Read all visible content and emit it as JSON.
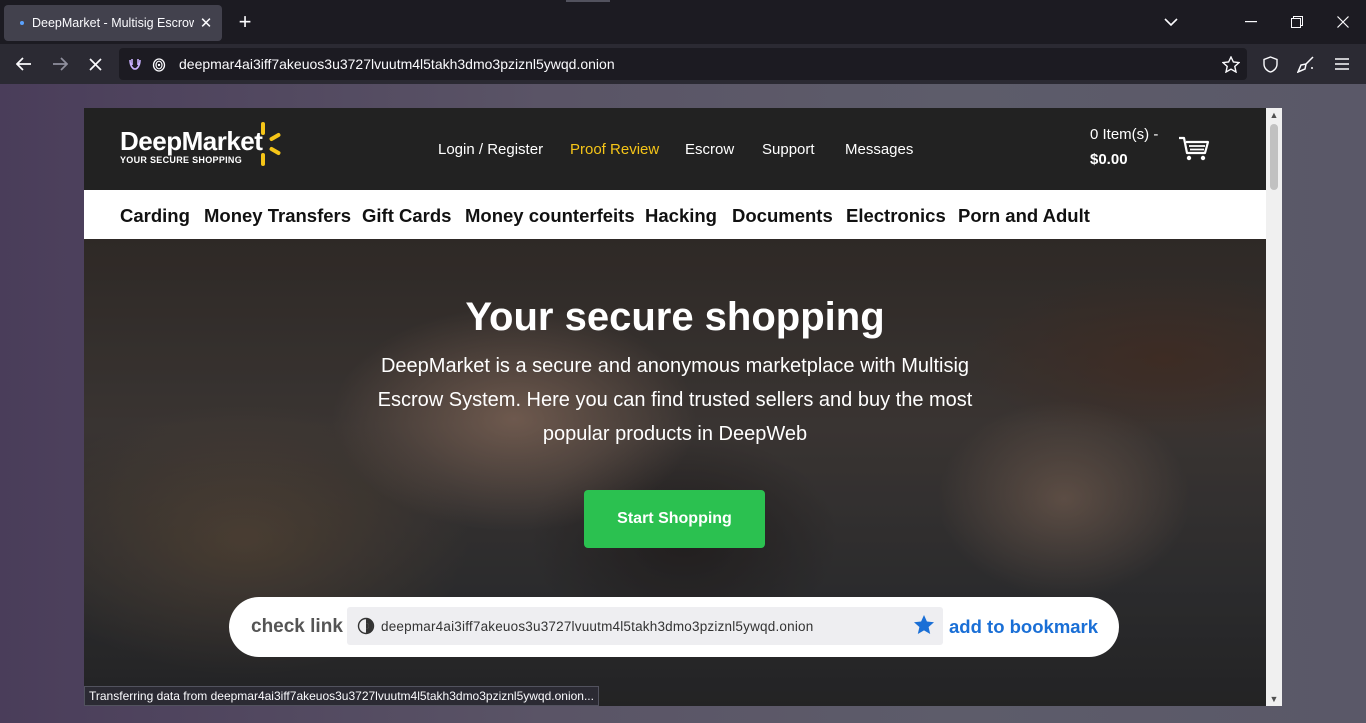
{
  "browser": {
    "tab_title": "DeepMarket - Multisig Escrow M",
    "new_tab": "+",
    "url": "deepmar4ai3iff7akeuos3u3727lvuutm4l5takh3dmo3pziznl5ywqd.onion",
    "status": "Transferring data from deepmar4ai3iff7akeuos3u3727lvuutm4l5takh3dmo3pziznl5ywqd.onion..."
  },
  "header": {
    "logo_name": "DeepMarket",
    "logo_tagline": "YOUR SECURE SHOPPING",
    "menu": [
      {
        "label": "Login / Register"
      },
      {
        "label": "Proof Review"
      },
      {
        "label": "Escrow"
      },
      {
        "label": "Support"
      },
      {
        "label": "Messages"
      }
    ],
    "cart_items": "0 Item(s) -",
    "cart_total": "$0.00"
  },
  "categories": [
    "Carding",
    "Money Transfers",
    "Gift Cards",
    "Money counterfeits",
    "Hacking",
    "Documents",
    "Electronics",
    "Porn and Adult"
  ],
  "hero": {
    "title": "Your secure shopping",
    "lead": "DeepMarket is a secure and anonymous marketplace with Multisig Escrow System. Here you can find trusted sellers and buy the most popular products in DeepWeb",
    "cta": "Start Shopping"
  },
  "checklink": {
    "label": "check link",
    "address": "deepmar4ai3iff7akeuos3u3727lvuutm4l5takh3dmo3pziznl5ywqd.onion",
    "bookmark": "add to bookmark"
  },
  "colors": {
    "accent_menu": "#f5c518",
    "cta_green": "#2bc150",
    "bookmark_blue": "#1a6fd6"
  }
}
